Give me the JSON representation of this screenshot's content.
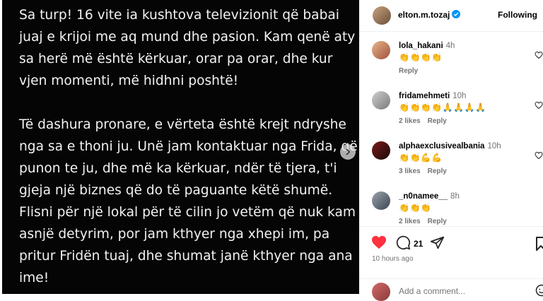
{
  "post": {
    "text": "Sa turp! 16 vite ia kushtova televizionit që babai\njuaj e krijoi me aq mund dhe pasion. Kam qenë aty\nsa herë më është kërkuar, orar pa orar, dhe kur\nvjen momenti, më hidhni poshtë!\n\nTë dashura pronare, e vërteta është krejt ndryshe\nnga sa e thoni ju. Unë jam kontaktuar nga Frida, që\npunon te ju, dhe më ka kërkuar, ndër të tjera, t'i\ngjeja një biznes që do të paguante këtë shumë.\nFlisni për një lokal për të cilin jo vetëm që nuk kam\nasnjë detyrim, por jam kthyer nga xhepi im, pa\npritur Fridën tuaj, dhe shumat janë kthyer nga ana\nime!"
  },
  "header": {
    "username": "elton.m.tozaj",
    "follow_label": "Following"
  },
  "comments": [
    {
      "username": "lola_hakani",
      "time": "4h",
      "text": "👏👏👏👏",
      "likes": "",
      "reply": "Reply"
    },
    {
      "username": "fridamehmeti",
      "time": "10h",
      "text": "👏👏👏👏🙏🙏🙏🙏",
      "likes": "2 likes",
      "reply": "Reply"
    },
    {
      "username": "alphaexclusivealbania",
      "time": "10h",
      "text": "👏👏💪💪",
      "likes": "3 likes",
      "reply": "Reply"
    },
    {
      "username": "_n0namee__",
      "time": "8h",
      "text": "👏👏👏",
      "likes": "2 likes",
      "reply": "Reply"
    }
  ],
  "actions": {
    "comment_count": "21",
    "time_ago": "10 hours ago",
    "add_comment_placeholder": "Add a comment..."
  },
  "icons": {
    "heart_color": "#ff3040",
    "verified_color": "#0095f6"
  }
}
